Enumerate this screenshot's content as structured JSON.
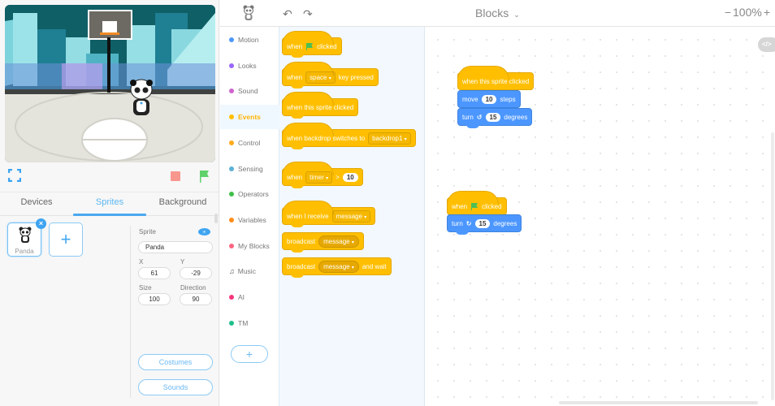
{
  "stage": {
    "controls": {
      "fullscreen": "fullscreen-icon",
      "stop": "stop-icon",
      "go": "green-flag-icon"
    },
    "colors": {
      "stop": "#f8978e",
      "flag": "#5fd26b",
      "accent": "#3ea4f1"
    }
  },
  "tabs": [
    {
      "label": "Devices",
      "active": false
    },
    {
      "label": "Sprites",
      "active": true
    },
    {
      "label": "Background",
      "active": false
    }
  ],
  "sprites": {
    "items": [
      {
        "name": "Panda",
        "selected": true
      }
    ],
    "delete_glyph": "×",
    "add_glyph": "+"
  },
  "sprite_props": {
    "sprite_label": "Sprite",
    "sprite_name": "Panda",
    "x_label": "X",
    "x_value": "61",
    "y_label": "Y",
    "y_value": "-29",
    "size_label": "Size",
    "size_value": "100",
    "direction_label": "Direction",
    "direction_value": "90",
    "costumes_label": "Costumes",
    "sounds_label": "Sounds"
  },
  "topbar": {
    "undo": "↶",
    "redo": "↷",
    "mode": "Blocks",
    "mode_chevron": "⌄",
    "zoom_out": "−",
    "zoom_level": "100%",
    "zoom_in": "+"
  },
  "categories": [
    {
      "label": "Motion",
      "color": "#4c97ff",
      "active": false
    },
    {
      "label": "Looks",
      "color": "#9966ff",
      "active": false
    },
    {
      "label": "Sound",
      "color": "#cf63cf",
      "active": false
    },
    {
      "label": "Events",
      "color": "#ffbf00",
      "active": true
    },
    {
      "label": "Control",
      "color": "#ffab19",
      "active": false
    },
    {
      "label": "Sensing",
      "color": "#5cb1d6",
      "active": false
    },
    {
      "label": "Operators",
      "color": "#40bf4a",
      "active": false
    },
    {
      "label": "Variables",
      "color": "#ff8c1a",
      "active": false
    },
    {
      "label": "My Blocks",
      "color": "#ff6680",
      "active": false
    },
    {
      "label": "Music",
      "color": "",
      "icon": "♫",
      "active": false
    },
    {
      "label": "AI",
      "color": "#f5367e",
      "active": false
    },
    {
      "label": "TM",
      "color": "#1fbf8c",
      "active": false
    }
  ],
  "category_add": "+",
  "flyout": {
    "b1": {
      "when": "when",
      "clicked": "clicked"
    },
    "b2": {
      "when": "when",
      "key": "space",
      "rest": "key pressed"
    },
    "b3": {
      "text": "when this sprite clicked"
    },
    "b4": {
      "text": "when backdrop switches to",
      "backdrop": "backdrop1"
    },
    "b5": {
      "when": "when",
      "sensor": "timer",
      "op": ">",
      "value": "10"
    },
    "b6": {
      "text": "when I receive",
      "message": "message"
    },
    "b7": {
      "text": "broadcast",
      "message": "message"
    },
    "b8": {
      "text": "broadcast",
      "message": "message",
      "rest": "and wait"
    }
  },
  "workspace": {
    "script1": {
      "hat": "when this sprite clicked",
      "move": {
        "a": "move",
        "value": "10",
        "b": "steps"
      },
      "turn": {
        "a": "turn",
        "dir": "↺",
        "value": "15",
        "b": "degrees"
      }
    },
    "script2": {
      "hat": {
        "when": "when",
        "clicked": "clicked"
      },
      "turn": {
        "a": "turn",
        "dir": "↻",
        "value": "15",
        "b": "degrees"
      }
    },
    "code_toggle": "</>"
  },
  "dd_arrow": "▾"
}
